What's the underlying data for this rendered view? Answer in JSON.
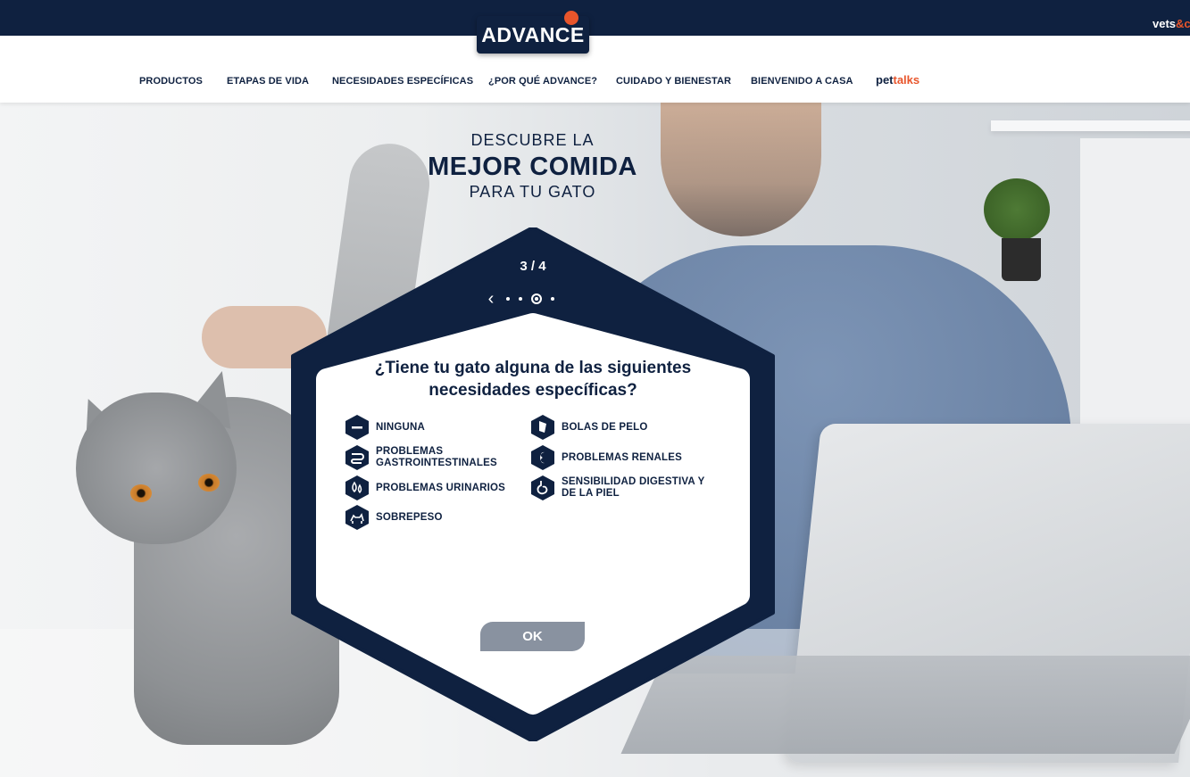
{
  "topbar": {
    "brand_logo": "ADVANCE",
    "vets_text": "vets",
    "vets_amp": "&c"
  },
  "nav": {
    "items": [
      "PRODUCTOS",
      "ETAPAS DE VIDA",
      "NECESIDADES ESPECÍFICAS",
      "¿POR QUÉ ADVANCE?",
      "CUIDADO Y BIENESTAR",
      "BIENVENIDO A CASA"
    ],
    "pettalks_pet": "pet",
    "pettalks_talks": "talks"
  },
  "hero": {
    "line1": "DESCUBRE LA",
    "line2": "MEJOR COMIDA",
    "line3": "PARA TU GATO"
  },
  "quiz": {
    "step": "3 / 4",
    "question": "¿Tiene tu gato alguna de las siguientes necesidades específicas?",
    "options_left": [
      {
        "label": "NINGUNA",
        "icon": "minus-icon"
      },
      {
        "label": "PROBLEMAS GASTROINTESTINALES",
        "icon": "stomach-icon"
      },
      {
        "label": "PROBLEMAS URINARIOS",
        "icon": "drops-icon"
      },
      {
        "label": "SOBREPESO",
        "icon": "cat-weight-icon"
      }
    ],
    "options_right": [
      {
        "label": "BOLAS DE PELO",
        "icon": "hairball-icon"
      },
      {
        "label": "PROBLEMAS RENALES",
        "icon": "kidney-icon"
      },
      {
        "label": "SENSIBILIDAD DIGESTIVA Y DE LA PIEL",
        "icon": "digestive-icon"
      }
    ],
    "ok_label": "OK"
  },
  "colors": {
    "navy": "#0f2140",
    "accent_orange": "#e8552b",
    "button_grey": "#8992a0"
  }
}
